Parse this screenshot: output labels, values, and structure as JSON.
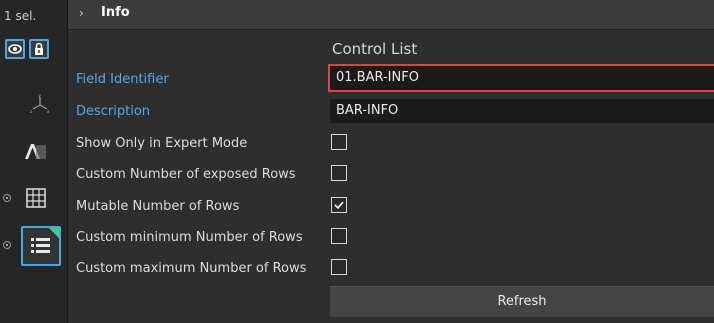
{
  "selection": {
    "count_label": "1 sel."
  },
  "header": {
    "chevron": "›",
    "title": "Info"
  },
  "left_icons": {
    "visibility": "eye-icon",
    "lock": "lock-icon",
    "axes": "axes-icon",
    "text": "text-layer-icon",
    "table": "table-icon",
    "list": "list-icon"
  },
  "section_title": "Control List",
  "fields": {
    "field_identifier": {
      "label": "Field Identifier",
      "value": "01.BAR-INFO"
    },
    "description": {
      "label": "Description",
      "value": "BAR-INFO"
    }
  },
  "options": [
    {
      "label": "Show Only in Expert Mode",
      "checked": false
    },
    {
      "label": "Custom Number of exposed Rows",
      "checked": false
    },
    {
      "label": "Mutable Number of Rows",
      "checked": true
    },
    {
      "label": "Custom minimum Number of Rows",
      "checked": false
    },
    {
      "label": "Custom maximum Number of Rows",
      "checked": false
    }
  ],
  "refresh_label": "Refresh",
  "colors": {
    "accent": "#49a9e6",
    "link": "#5ba8e8",
    "highlight": "#d94545"
  }
}
